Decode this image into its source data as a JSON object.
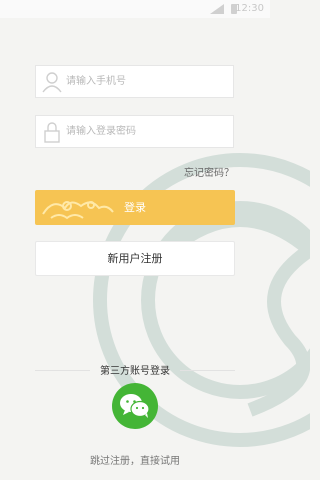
{
  "status_bar": {
    "time": "12:30"
  },
  "form": {
    "phone_placeholder": "请输入手机号",
    "password_placeholder": "请输入登录密码",
    "forgot_password": "忘记密码？"
  },
  "buttons": {
    "login": "登录",
    "register": "新用户注册"
  },
  "third_party": {
    "title": "第三方账号登录",
    "provider": "wechat"
  },
  "skip": "跳过注册，直接试用",
  "colors": {
    "accent": "#f6c453",
    "wechat": "#44b536",
    "background": "#f4f4f2"
  }
}
